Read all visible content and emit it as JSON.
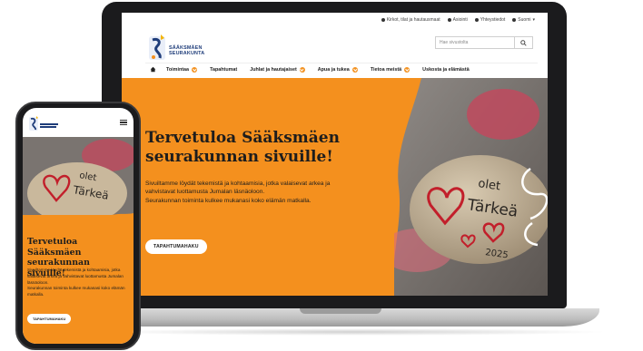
{
  "utility_nav": {
    "items": [
      "Kirkot, tilat ja hautausmaat",
      "Asiointi",
      "Yhteystiedot",
      "Suomi"
    ]
  },
  "logo": {
    "name_line1": "SÄÄKSMÄEN",
    "name_line2": "SEURAKUNTA"
  },
  "search": {
    "placeholder": "Hae sivustolta"
  },
  "main_nav": {
    "items": [
      {
        "label": "Toimintaa"
      },
      {
        "label": "Tapahtumat"
      },
      {
        "label": "Juhlat ja hautajaiset"
      },
      {
        "label": "Apua ja tukea"
      },
      {
        "label": "Tietoa meistä"
      },
      {
        "label": "Uskosta ja elämästä"
      }
    ]
  },
  "hero": {
    "title": "Tervetuloa Sääksmäen seurakunnan sivuille!",
    "text1": "Sivuiltamme löydät tekemistä ja kohtaamisia, jotka valaisevat arkea ja vahvistavat luottamusta Jumalan läsnäoloon.",
    "text2": "Seurakunnan toiminta kulkee mukanasi koko elämän matkalla.",
    "button": "TAPAHTUMAHAKU",
    "stone_text": "olet Tärkeä 2025"
  },
  "colors": {
    "accent_orange": "#f4901e",
    "brand_blue": "#1f3d7a",
    "text_dark": "#1d1d1d"
  }
}
